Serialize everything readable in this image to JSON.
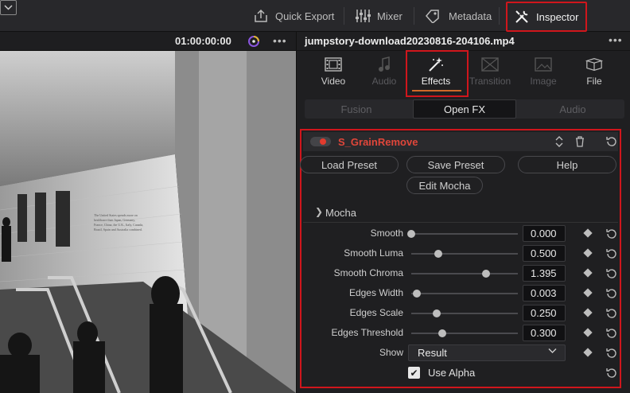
{
  "toolbar": {
    "quick_export": "Quick Export",
    "mixer": "Mixer",
    "metadata": "Metadata",
    "inspector": "Inspector"
  },
  "viewer": {
    "timecode": "01:00:00:00",
    "menu": "•••"
  },
  "clip": {
    "name": "jumpstory-download20230816-204106.mp4",
    "menu": "•••"
  },
  "tabs": [
    {
      "label": "Video",
      "icon": "film-icon",
      "state": "enabled"
    },
    {
      "label": "Audio",
      "icon": "music-note-icon",
      "state": "disabled"
    },
    {
      "label": "Effects",
      "icon": "magic-wand-icon",
      "state": "active"
    },
    {
      "label": "Transition",
      "icon": "transition-icon",
      "state": "disabled"
    },
    {
      "label": "Image",
      "icon": "image-icon",
      "state": "disabled"
    },
    {
      "label": "File",
      "icon": "file-icon",
      "state": "enabled"
    }
  ],
  "subtabs": [
    {
      "label": "Fusion",
      "active": false
    },
    {
      "label": "Open FX",
      "active": true
    },
    {
      "label": "Audio",
      "active": false
    }
  ],
  "effect": {
    "name": "S_GrainRemove",
    "enabled": true,
    "buttons": {
      "load_preset": "Load Preset",
      "save_preset": "Save Preset",
      "help": "Help",
      "edit_mocha": "Edit Mocha"
    },
    "mocha_label": "Mocha",
    "params": [
      {
        "label": "Smooth",
        "value": "0.000",
        "slider": 0.0
      },
      {
        "label": "Smooth Luma",
        "value": "0.500",
        "slider": 0.25
      },
      {
        "label": "Smooth Chroma",
        "value": "1.395",
        "slider": 0.7
      },
      {
        "label": "Edges Width",
        "value": "0.003",
        "slider": 0.05
      },
      {
        "label": "Edges Scale",
        "value": "0.250",
        "slider": 0.24
      },
      {
        "label": "Edges Threshold",
        "value": "0.300",
        "slider": 0.29
      }
    ],
    "show": {
      "label": "Show",
      "value": "Result"
    },
    "use_alpha": {
      "label": "Use Alpha",
      "checked": true
    }
  },
  "colors": {
    "highlight": "#d0161c",
    "effect_name": "#e0463a",
    "accent_underline": "#d06a28"
  }
}
